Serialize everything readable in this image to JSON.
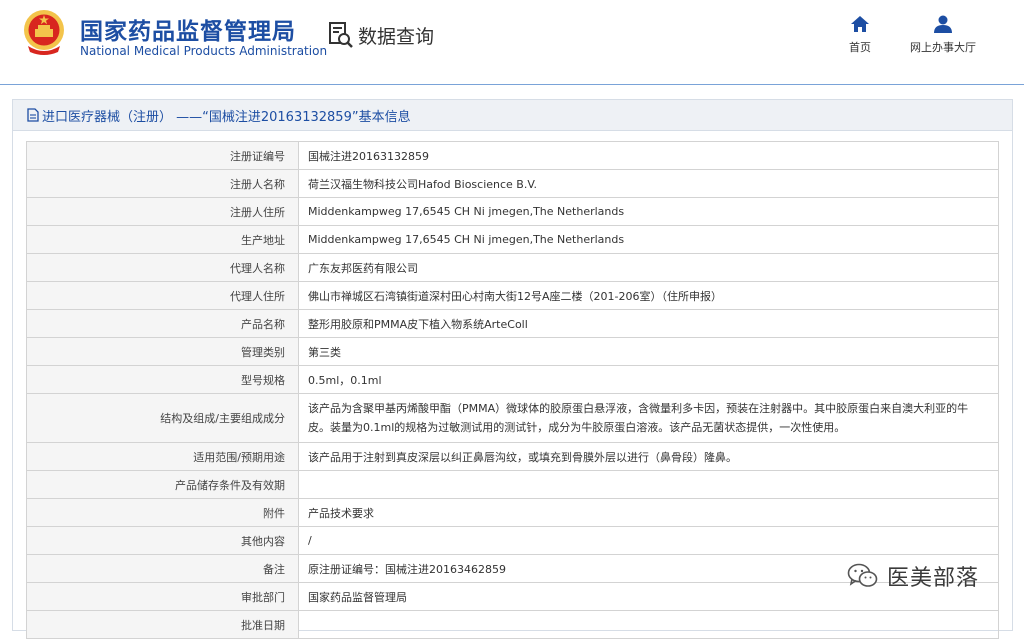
{
  "header": {
    "title_zh": "国家药品监督管理局",
    "title_en": "National Medical Products Administration",
    "query_label": "数据查询",
    "nav": {
      "home": "首页",
      "service_hall": "网上办事大厅"
    }
  },
  "breadcrumb": {
    "text": "进口医疗器械（注册） ——“国械注进20163132859”基本信息"
  },
  "info_rows": [
    {
      "key": "注册证编号",
      "value": "国械注进20163132859"
    },
    {
      "key": "注册人名称",
      "value": "荷兰汉福生物科技公司Hafod Bioscience B.V."
    },
    {
      "key": "注册人住所",
      "value": "Middenkampweg 17,6545 CH Ni jmegen,The Netherlands"
    },
    {
      "key": "生产地址",
      "value": "Middenkampweg 17,6545 CH Ni jmegen,The Netherlands"
    },
    {
      "key": "代理人名称",
      "value": "广东友邦医药有限公司"
    },
    {
      "key": "代理人住所",
      "value": "佛山市禅城区石湾镇街道深村田心村南大街12号A座二楼（201-206室）（住所申报）"
    },
    {
      "key": "产品名称",
      "value": "整形用胶原和PMMA皮下植入物系统ArteColl"
    },
    {
      "key": "管理类别",
      "value": "第三类"
    },
    {
      "key": "型号规格",
      "value": "0.5ml，0.1ml"
    },
    {
      "key": "结构及组成/主要组成成分",
      "value": "该产品为含聚甲基丙烯酸甲酯（PMMA）微球体的胶原蛋白悬浮液，含微量利多卡因，预装在注射器中。其中胶原蛋白来自澳大利亚的牛皮。装量为0.1ml的规格为过敏测试用的测试针，成分为牛胶原蛋白溶液。该产品无菌状态提供，一次性使用。"
    },
    {
      "key": "适用范围/预期用途",
      "value": "该产品用于注射到真皮深层以纠正鼻唇沟纹，或填充到骨膜外层以进行（鼻骨段）隆鼻。"
    },
    {
      "key": "产品储存条件及有效期",
      "value": ""
    },
    {
      "key": "附件",
      "value": "产品技术要求"
    },
    {
      "key": "其他内容",
      "value": "/"
    },
    {
      "key": "备注",
      "value": "原注册证编号：国械注进20163462859"
    },
    {
      "key": "审批部门",
      "value": "国家药品监督管理局"
    },
    {
      "key": "批准日期",
      "value": ""
    }
  ],
  "watermark": {
    "text": "医美部落"
  },
  "colors": {
    "brand_blue": "#1d4ea3",
    "row_key_bg": "#f5f5f5",
    "emblem_red": "#d8261f",
    "emblem_gold": "#f3c44b"
  },
  "icons": {
    "emblem": "national-emblem-icon",
    "query": "document-search-icon",
    "home": "home-icon",
    "user": "user-icon",
    "wechat": "wechat-icon"
  }
}
